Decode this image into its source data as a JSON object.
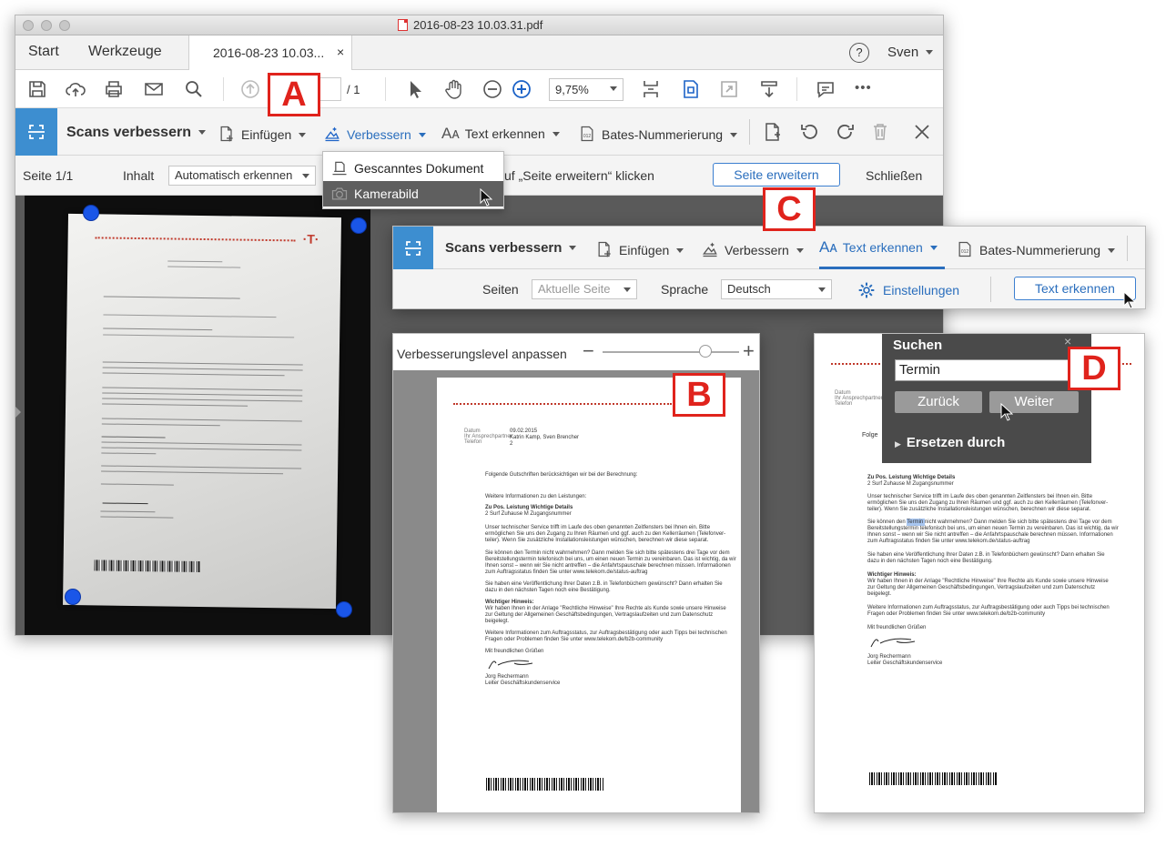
{
  "window": {
    "title": "2016-08-23 10.03.31.pdf"
  },
  "tabs": {
    "start": "Start",
    "tools": "Werkzeuge",
    "doc_tab": "2016-08-23 10.03...",
    "close": "×",
    "help": "?",
    "user": "Sven"
  },
  "toolbar": {
    "page_current": "",
    "page_total": "/ 1",
    "zoom": "9,75%",
    "more": "•••"
  },
  "scan_toolbar": {
    "title": "Scans verbessern",
    "insert": "Einfügen",
    "enhance": "Verbessern",
    "recognize": "Text erkennen",
    "bates": "Bates-Nummerierung"
  },
  "enhance_menu": {
    "items": [
      "Gescanntes Dokument",
      "Kamerabild"
    ]
  },
  "subbar": {
    "page": "Seite 1/1",
    "content_label": "Inhalt",
    "content_value": "Automatisch erkennen",
    "hint": "uf „Seite erweitern“ klicken",
    "expand_button": "Seite erweitern",
    "close": "Schließen"
  },
  "callouts": {
    "a": "A",
    "b": "B",
    "c": "C",
    "d": "D"
  },
  "panel_c": {
    "title": "Scans verbessern",
    "insert": "Einfügen",
    "enhance": "Verbessern",
    "recognize": "Text erkennen",
    "bates": "Bates-Nummerierung",
    "pages_label": "Seiten",
    "pages_value": "Aktuelle Seite",
    "lang_label": "Sprache",
    "lang_value": "Deutsch",
    "settings": "Einstellungen",
    "recognize_button": "Text erkennen"
  },
  "panel_b": {
    "slider_label": "Verbesserungslevel anpassen",
    "slider_value": 0.75,
    "minus": "−",
    "plus": "+"
  },
  "panel_d": {
    "search_title": "Suchen",
    "search_value": "Termin",
    "back": "Zurück",
    "next": "Weiter",
    "replace": "Ersetzen durch"
  },
  "letter": {
    "date": "09.02.2015",
    "contact": "Katrin Kamp,  Sven Brencher",
    "num": "2",
    "line1": "Folgende Gutschriften berücksichtigen wir bei der Berechnung:",
    "line2": "Weitere Informationen zu den Leistungen:",
    "table_head": "Zu Pos.       Leistung                                      Wichtige Details",
    "table_row": "2                 Surf Zuhause M              Zugangsnummer",
    "para1a": "Unser technischer Service trifft im Laufe des oben genannten Zeitfensters bei Ihnen ein. Bitte",
    "para1b": "ermöglichen Sie uns den Zugang zu Ihren Räumen und ggf. auch zu den Kellerräumen (Telefonver-",
    "para1c": "teiler). Wenn Sie zusätzliche Installationsleistungen wünschen, berechnen wir diese separat.",
    "para2a": "Sie können den Termin nicht wahrnehmen? Dann melden Sie sich bitte spätestens drei Tage vor dem",
    "para2b": "Bereitstellungstermin telefonisch bei uns, um einen neuen Termin zu vereinbaren. Das ist wichtig, da wir",
    "para2c": "Ihnen sonst – wenn wir Sie nicht antreffen – die Anfahrtspauschale berechnen müssen. Informationen",
    "para2d": "zum Auftragsstatus finden Sie unter www.telekom.de/status-auftrag",
    "para3a": "Sie haben eine Veröffentlichung Ihrer Daten z.B. in Telefonbüchern gewünscht? Dann erhalten Sie",
    "para3b": "dazu in den nächsten Tagen noch eine Bestätigung.",
    "important": "Wichtiger Hinweis:",
    "para4a": "Wir haben Ihnen in der Anlage \"Rechtliche Hinweise\" Ihre Rechte als Kunde sowie unsere Hinweise",
    "para4b": "zur Geltung der Allgemeinen Geschäftsbedingungen, Vertragslaufzeiten und zum Datenschutz",
    "para4c": "beigelegt.",
    "para5a": "Weitere Informationen zum Auftragsstatus, zur Auftragsbestätigung oder auch Tipps bei technischen",
    "para5b": "Fragen oder Problemen finden Sie unter www.telekom.de/b2b-community",
    "greeting": "Mit freundlichen Grüßen",
    "name": "Jorg Rechermann",
    "role": "Leiter Geschäftskundenservice"
  },
  "colors": {
    "accent": "#2a6ebd",
    "callout_red": "#e0231c",
    "handle_blue": "#1a56e8",
    "telekom_dots": "#c0392b"
  }
}
